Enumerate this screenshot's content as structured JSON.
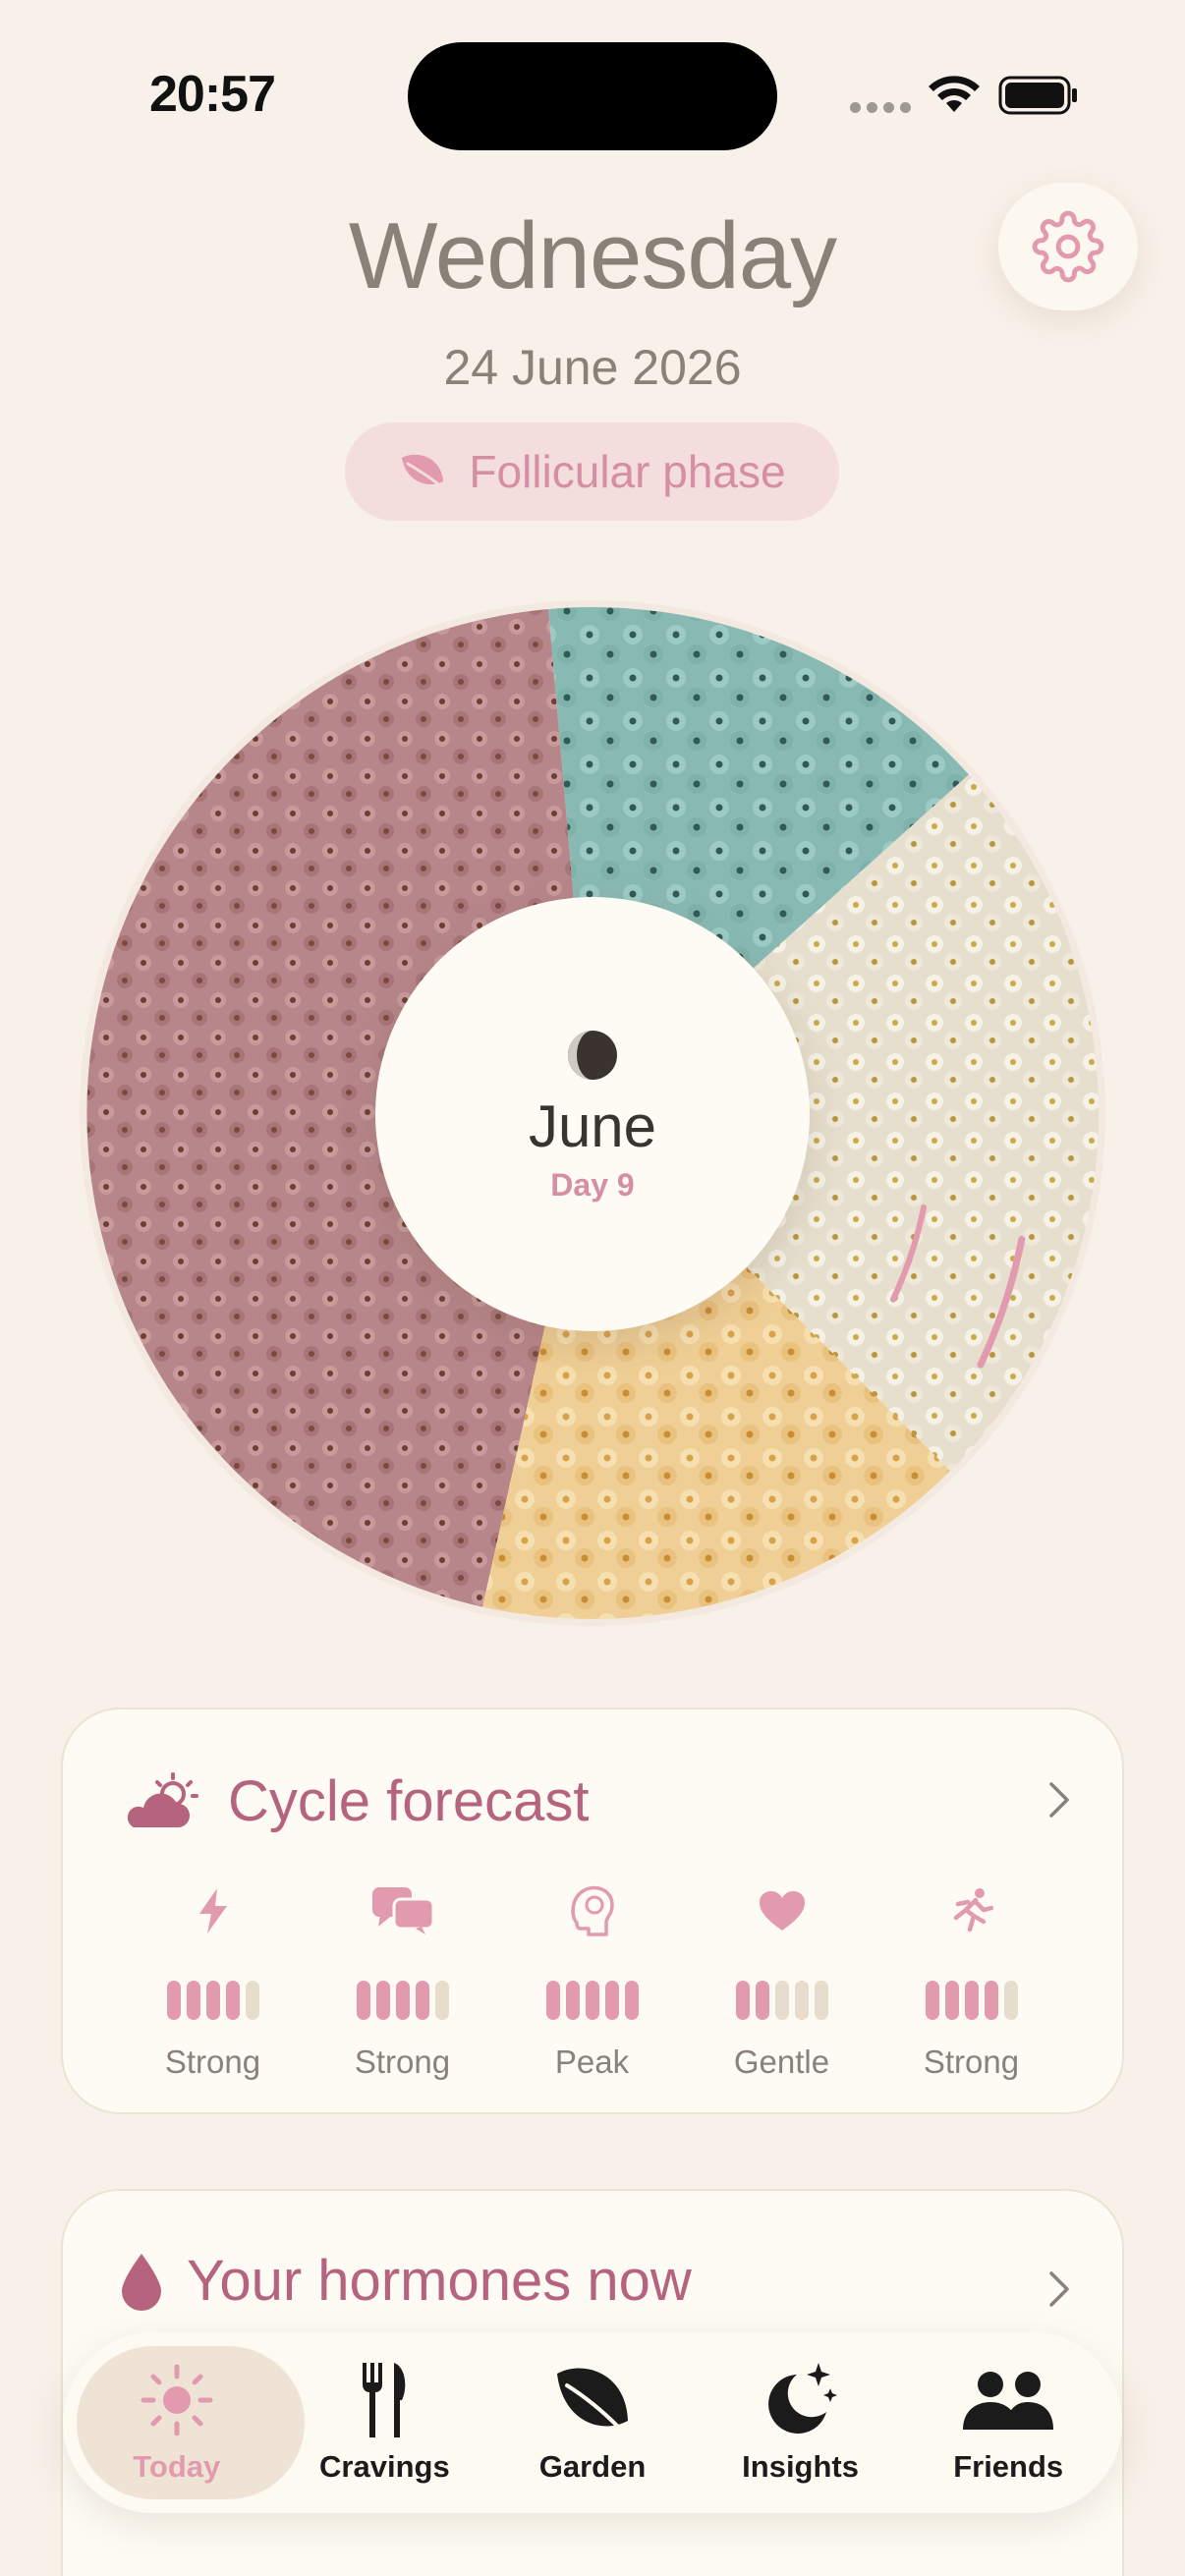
{
  "status_bar": {
    "time": "20:57"
  },
  "header": {
    "day": "Wednesday",
    "date": "24 June 2026",
    "phase": "Follicular phase"
  },
  "cycle_wheel": {
    "month": "June",
    "day": "Day 9",
    "colors": {
      "menstrual": "#b6868a",
      "follicular": "#8fc1bb",
      "ovulatory": "#e9e3d3",
      "luteal": "#efcf95",
      "marker": "#e29aaf"
    }
  },
  "forecast": {
    "title": "Cycle forecast",
    "metrics": [
      {
        "icon": "lightning-icon",
        "filled": 4,
        "total": 5,
        "level": "Strong"
      },
      {
        "icon": "chat-bubbles-icon",
        "filled": 4,
        "total": 5,
        "level": "Strong"
      },
      {
        "icon": "brain-icon",
        "filled": 5,
        "total": 5,
        "level": "Peak"
      },
      {
        "icon": "heart-icon",
        "filled": 2,
        "total": 5,
        "level": "Gentle"
      },
      {
        "icon": "running-icon",
        "filled": 4,
        "total": 5,
        "level": "Strong"
      }
    ]
  },
  "hormones": {
    "title": "Your hormones now"
  },
  "tab_bar": {
    "active": "Today",
    "tabs": [
      {
        "label": "Today",
        "icon": "sun-icon"
      },
      {
        "label": "Cravings",
        "icon": "fork-knife-icon"
      },
      {
        "label": "Garden",
        "icon": "leaf-icon"
      },
      {
        "label": "Insights",
        "icon": "moon-stars-icon"
      },
      {
        "label": "Friends",
        "icon": "people-icon"
      }
    ]
  },
  "theme": {
    "accent": "#e29aaf",
    "title_pink": "#b5637f",
    "background": "#f8f1e9"
  }
}
